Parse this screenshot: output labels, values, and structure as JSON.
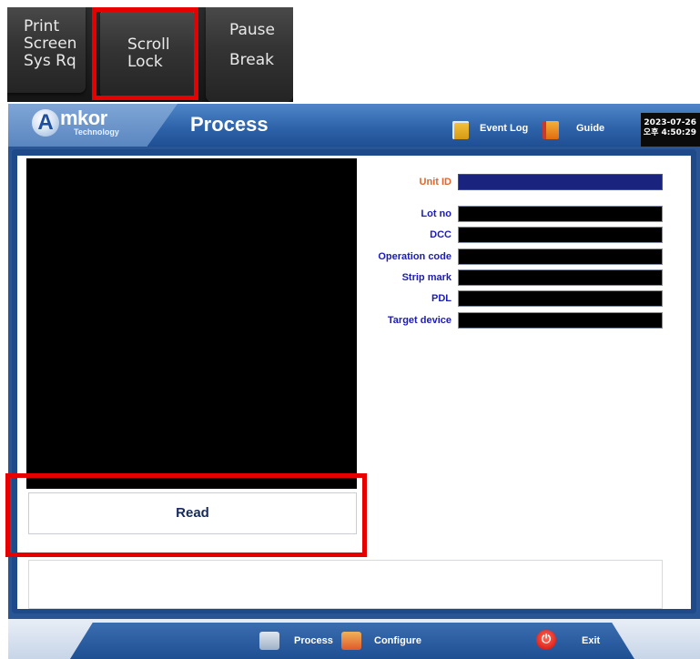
{
  "keyboard": {
    "print_screen": [
      "Print",
      "Screen",
      "Sys Rq"
    ],
    "scroll_lock": [
      "Scroll",
      "Lock"
    ],
    "pause_break": [
      "Pause",
      "Break"
    ]
  },
  "header": {
    "logo_letter": "A",
    "logo_word": "mkor",
    "logo_sub": "Technology",
    "title": "Process",
    "event_log_label": "Event Log",
    "guide_label": "Guide",
    "clock_date": "2023-07-26",
    "clock_time": "오후 4:50:29"
  },
  "fields": [
    {
      "label": "Unit ID",
      "value": ""
    },
    {
      "label": "Lot no",
      "value": ""
    },
    {
      "label": "DCC",
      "value": ""
    },
    {
      "label": "Operation code",
      "value": ""
    },
    {
      "label": "Strip mark",
      "value": ""
    },
    {
      "label": "PDL",
      "value": ""
    },
    {
      "label": "Target device",
      "value": ""
    }
  ],
  "main": {
    "read_button": "Read",
    "message": ""
  },
  "footer": {
    "process_label": "Process",
    "configure_label": "Configure",
    "exit_label": "Exit"
  },
  "colors": {
    "accent_highlight": "#e60000",
    "header_blue": "#2f64aa",
    "unit_id_label": "#e0662b",
    "field_label": "#1c1cb4"
  },
  "icons": [
    "event-log-icon",
    "guide-icon",
    "process-icon",
    "configure-icon",
    "power-icon"
  ]
}
